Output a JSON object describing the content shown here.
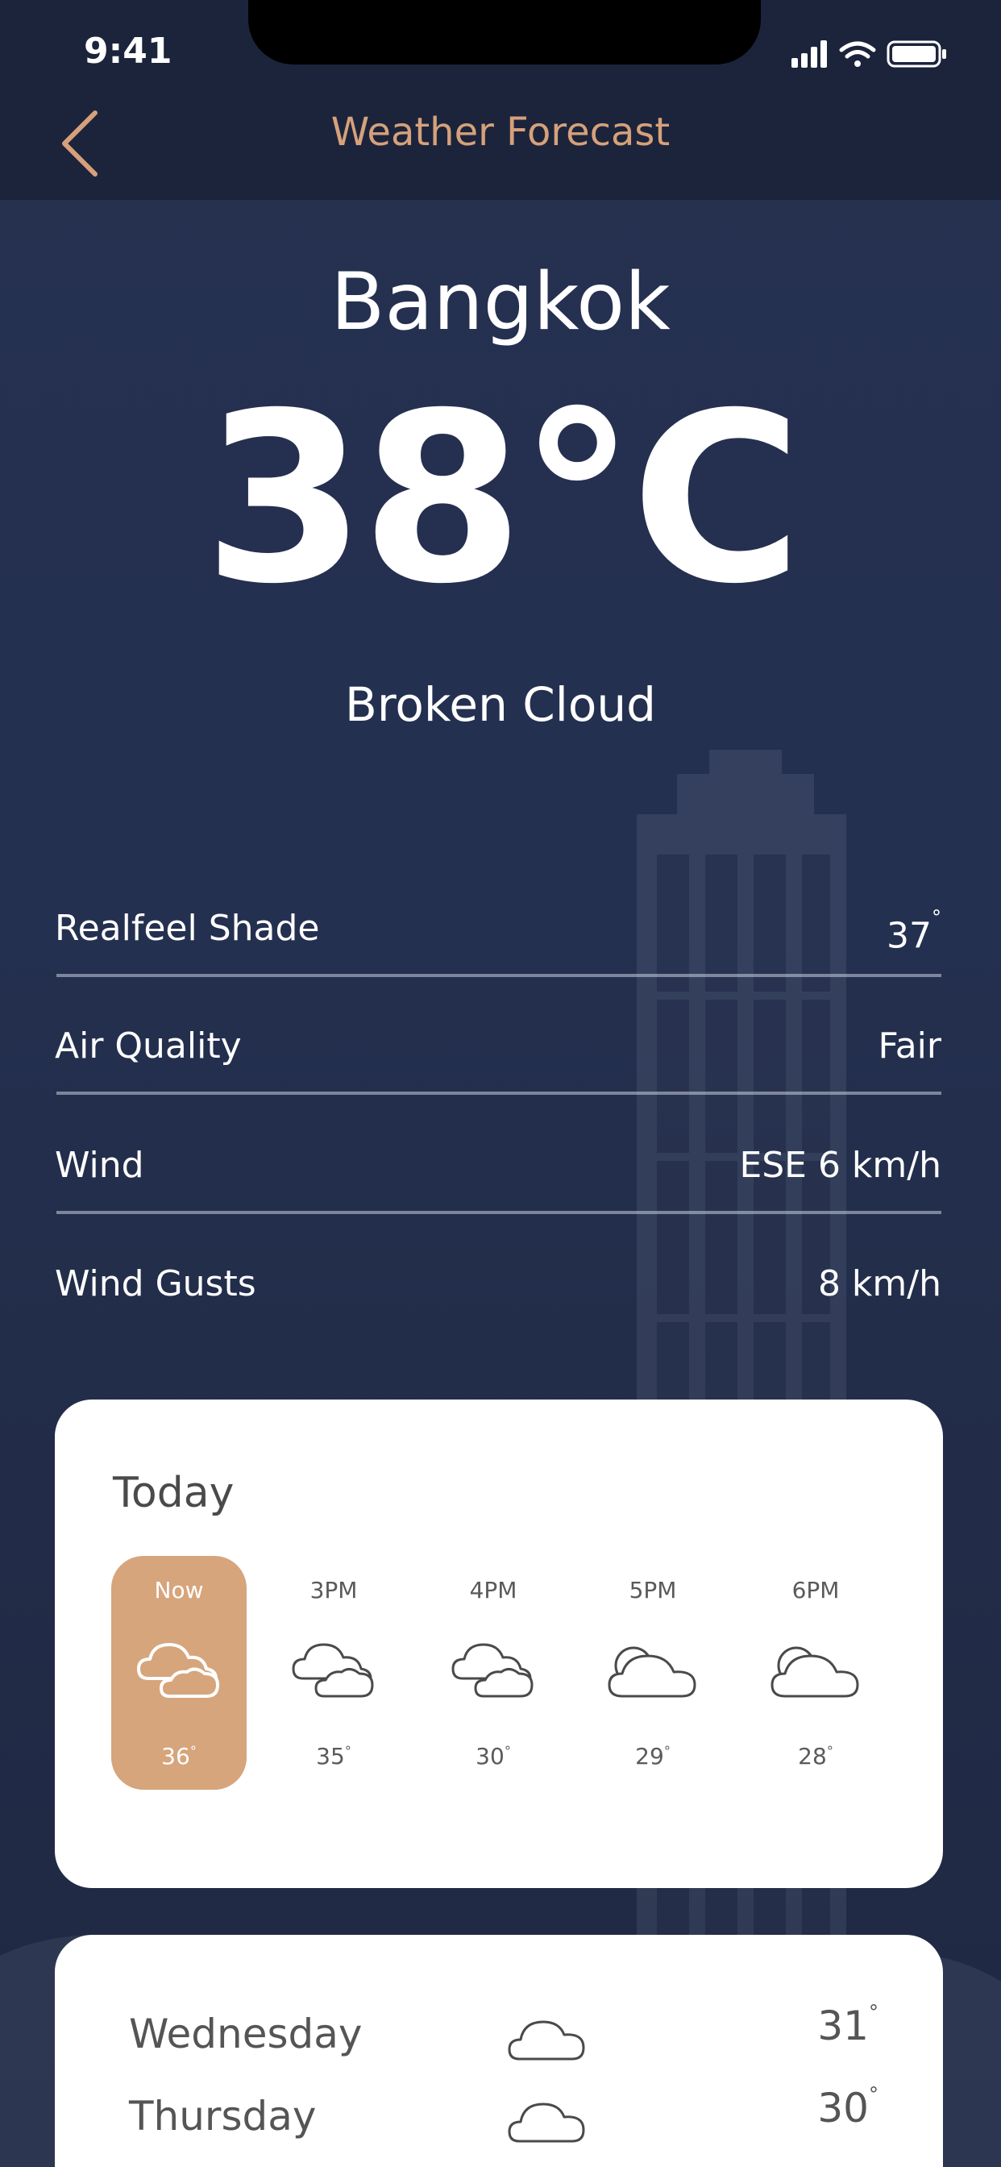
{
  "status_bar": {
    "time": "9:41",
    "icons": [
      "signal-icon",
      "wifi-icon",
      "battery-icon"
    ]
  },
  "nav": {
    "title": "Weather Forecast",
    "back_icon": "chevron-left-icon"
  },
  "current": {
    "city": "Bangkok",
    "temperature": "38",
    "unit": "°C",
    "condition": "Broken Cloud"
  },
  "details": [
    {
      "label": "Realfeel Shade",
      "value": "37",
      "degree": "°"
    },
    {
      "label": "Air Quality",
      "value": "Fair",
      "degree": ""
    },
    {
      "label": "Wind",
      "value": "ESE 6 km/h",
      "degree": ""
    },
    {
      "label": "Wind Gusts",
      "value": "8 km/h",
      "degree": ""
    }
  ],
  "today": {
    "title": "Today",
    "hours": [
      {
        "label": "Now",
        "temp": "36",
        "icon": "cloudy-icon",
        "active": true
      },
      {
        "label": "3PM",
        "temp": "35",
        "icon": "cloudy-icon",
        "active": false
      },
      {
        "label": "4PM",
        "temp": "30",
        "icon": "cloudy-icon",
        "active": false
      },
      {
        "label": "5PM",
        "temp": "29",
        "icon": "partly-cloudy-icon",
        "active": false
      },
      {
        "label": "6PM",
        "temp": "28",
        "icon": "partly-cloudy-icon",
        "active": false
      }
    ]
  },
  "week": [
    {
      "day": "Wednesday",
      "temp": "31",
      "icon": "cloud-icon"
    },
    {
      "day": "Thursday",
      "temp": "30",
      "icon": "cloud-icon"
    }
  ],
  "colors": {
    "accent": "#d6a17a",
    "background": "#243050",
    "card": "#ffffff",
    "active_hour": "#d6a57c"
  }
}
